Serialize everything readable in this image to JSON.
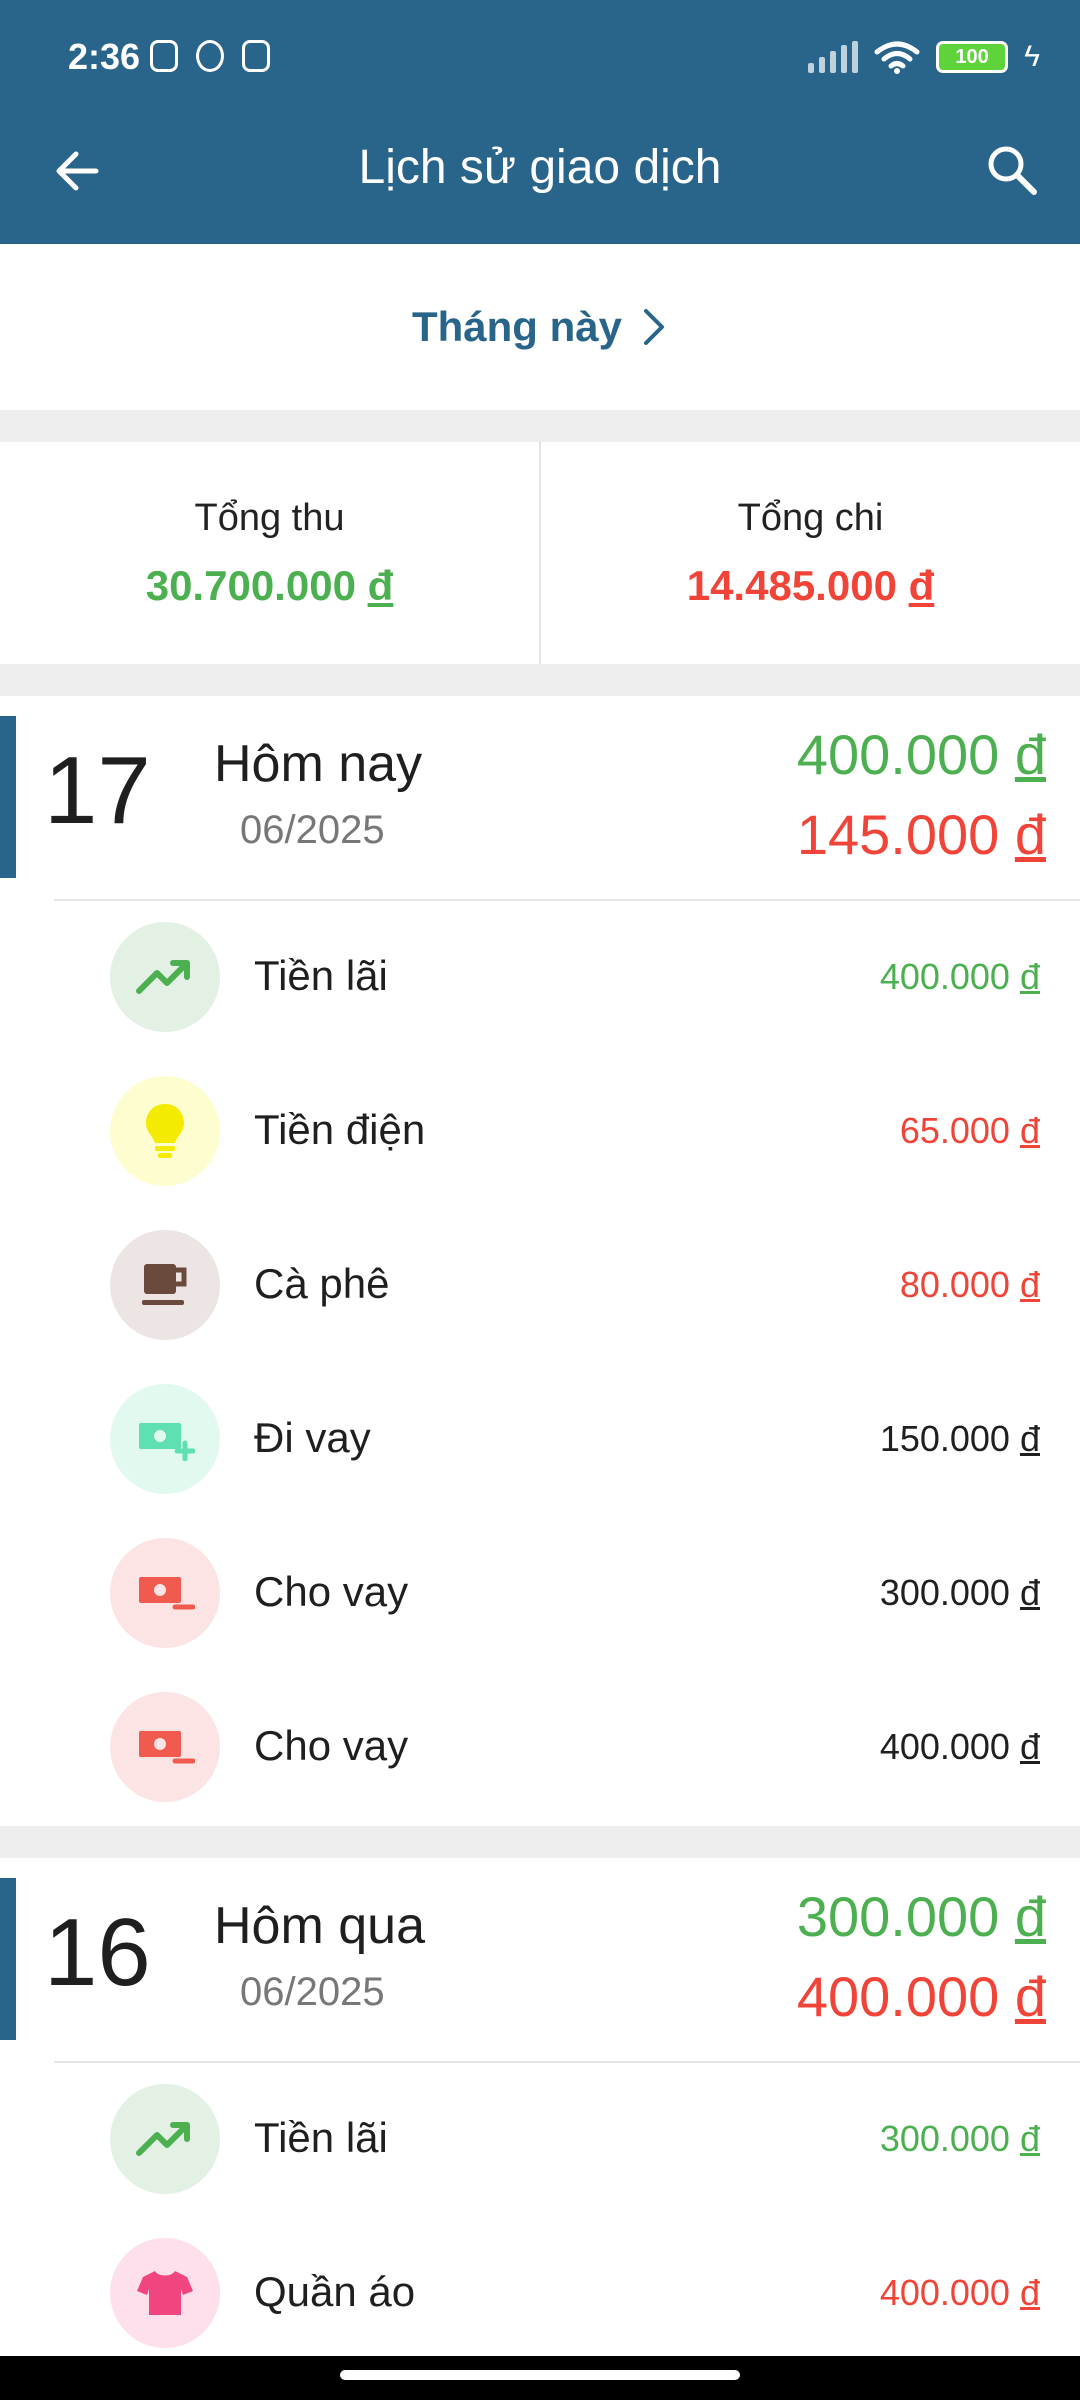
{
  "status": {
    "time": "2:36",
    "battery": "100"
  },
  "toolbar": {
    "title": "Lịch sử giao dịch",
    "back_icon": "arrow-left-icon",
    "search_icon": "search-icon"
  },
  "period": {
    "label": "Tháng này",
    "icon": "chevron-right-icon"
  },
  "totals": {
    "income_label": "Tổng thu",
    "income_value": "30.700.000",
    "expense_label": "Tổng chi",
    "expense_value": "14.485.000",
    "currency": "đ"
  },
  "colors": {
    "primary": "#29658a",
    "income": "#4caf50",
    "expense": "#f04438"
  },
  "days": [
    {
      "day": "17",
      "label": "Hôm nay",
      "month": "06/2025",
      "income": "400.000",
      "expense": "145.000",
      "items": [
        {
          "name": "Tiền lãi",
          "amount": "400.000",
          "type": "income",
          "icon": "trending-up-icon"
        },
        {
          "name": "Tiền điện",
          "amount": "65.000",
          "type": "expense",
          "icon": "lightbulb-icon"
        },
        {
          "name": "Cà phê",
          "amount": "80.000",
          "type": "expense",
          "icon": "coffee-cup-icon"
        },
        {
          "name": "Đi vay",
          "amount": "150.000",
          "type": "neutral",
          "icon": "money-plus-icon"
        },
        {
          "name": "Cho vay",
          "amount": "300.000",
          "type": "neutral",
          "icon": "money-minus-icon"
        },
        {
          "name": "Cho vay",
          "amount": "400.000",
          "type": "neutral",
          "icon": "money-minus-icon"
        }
      ]
    },
    {
      "day": "16",
      "label": "Hôm qua",
      "month": "06/2025",
      "income": "300.000",
      "expense": "400.000",
      "items": [
        {
          "name": "Tiền lãi",
          "amount": "300.000",
          "type": "income",
          "icon": "trending-up-icon"
        },
        {
          "name": "Quần áo",
          "amount": "400.000",
          "type": "expense",
          "icon": "tshirt-icon"
        }
      ]
    }
  ]
}
